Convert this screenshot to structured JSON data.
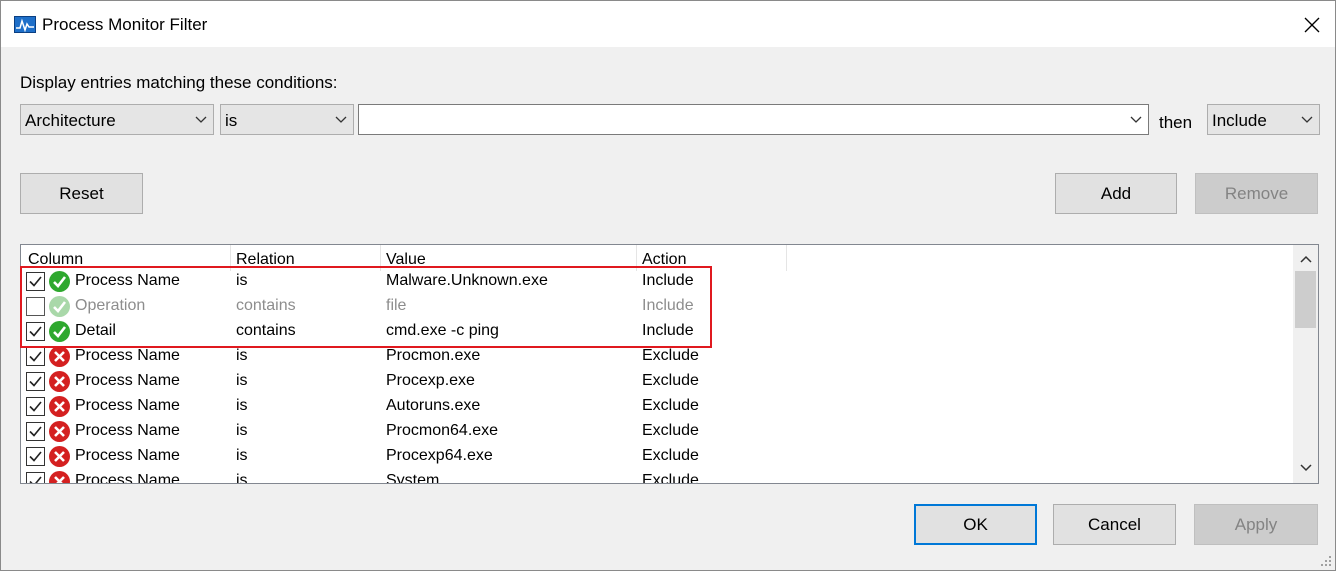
{
  "window": {
    "title": "Process Monitor Filter"
  },
  "filter": {
    "prompt": "Display entries matching these conditions:",
    "column_select": "Architecture",
    "relation_select": "is",
    "value_input": "",
    "then_label": "then",
    "action_select": "Include"
  },
  "buttons": {
    "reset": "Reset",
    "add": "Add",
    "remove": "Remove",
    "ok": "OK",
    "cancel": "Cancel",
    "apply": "Apply"
  },
  "table": {
    "headers": [
      "Column",
      "Relation",
      "Value",
      "Action"
    ],
    "rows": [
      {
        "checked": true,
        "icon": "include-icon",
        "enabled": true,
        "column": "Process Name",
        "relation": "is",
        "value": "Malware.Unknown.exe",
        "action": "Include"
      },
      {
        "checked": false,
        "icon": "include-icon",
        "enabled": false,
        "column": "Operation",
        "relation": "contains",
        "value": "file",
        "action": "Include"
      },
      {
        "checked": true,
        "icon": "include-icon",
        "enabled": true,
        "column": "Detail",
        "relation": "contains",
        "value": "cmd.exe -c ping",
        "action": "Include"
      },
      {
        "checked": true,
        "icon": "exclude-icon",
        "enabled": true,
        "column": "Process Name",
        "relation": "is",
        "value": "Procmon.exe",
        "action": "Exclude"
      },
      {
        "checked": true,
        "icon": "exclude-icon",
        "enabled": true,
        "column": "Process Name",
        "relation": "is",
        "value": "Procexp.exe",
        "action": "Exclude"
      },
      {
        "checked": true,
        "icon": "exclude-icon",
        "enabled": true,
        "column": "Process Name",
        "relation": "is",
        "value": "Autoruns.exe",
        "action": "Exclude"
      },
      {
        "checked": true,
        "icon": "exclude-icon",
        "enabled": true,
        "column": "Process Name",
        "relation": "is",
        "value": "Procmon64.exe",
        "action": "Exclude"
      },
      {
        "checked": true,
        "icon": "exclude-icon",
        "enabled": true,
        "column": "Process Name",
        "relation": "is",
        "value": "Procexp64.exe",
        "action": "Exclude"
      },
      {
        "checked": true,
        "icon": "exclude-icon",
        "enabled": true,
        "column": "Process Name",
        "relation": "is",
        "value": "System",
        "action": "Exclude"
      }
    ]
  },
  "colors": {
    "highlight": "#e0191f",
    "accent": "#0078d7",
    "include_green": "#2ea82e",
    "exclude_red": "#d42020"
  }
}
